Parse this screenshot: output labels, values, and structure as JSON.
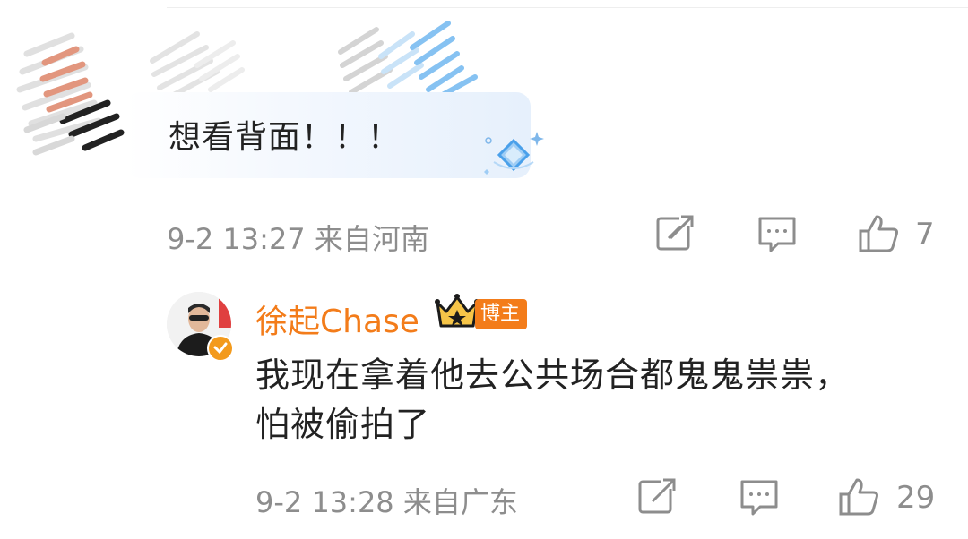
{
  "comments": [
    {
      "text": "想看背面！！！",
      "timestamp": "9-2 13:27",
      "location": "来自河南",
      "like_count": "7",
      "icons": [
        "repost-icon",
        "comment-icon",
        "like-icon",
        "gem-badge-icon"
      ]
    }
  ],
  "reply": {
    "username": "徐起Chase",
    "role_badge": "博主",
    "text_line1": "我现在拿着他去公共场合都鬼鬼祟祟，",
    "text_line2": "怕被偷拍了",
    "timestamp": "9-2 13:28",
    "location": "来自广东",
    "like_count": "29",
    "icons": [
      "crown-icon",
      "verified-badge-icon",
      "repost-icon",
      "comment-icon",
      "like-icon"
    ]
  },
  "colors": {
    "username": "#f37c1a",
    "badge": "#f37c1a",
    "meta": "#8d8d8d",
    "text": "#222222",
    "bubble": "#e6f0fc"
  }
}
